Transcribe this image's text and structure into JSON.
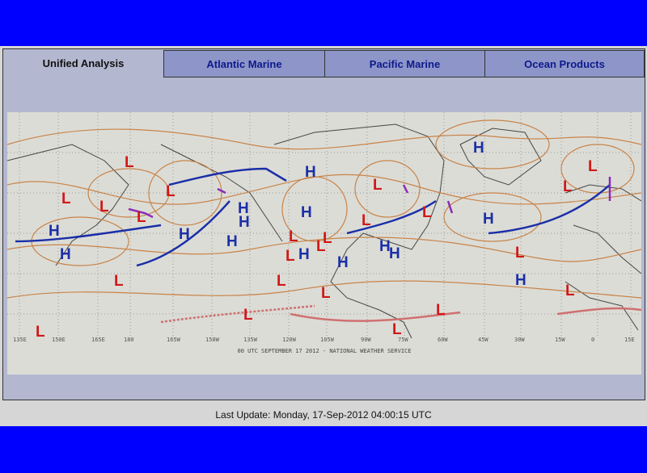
{
  "tabs": [
    {
      "label": "Unified Analysis",
      "active": true
    },
    {
      "label": "Atlantic Marine"
    },
    {
      "label": "Pacific Marine"
    },
    {
      "label": "Ocean Products"
    }
  ],
  "map": {
    "caption": "00 UTC SEPTEMBER 17 2012 - NATIONAL WEATHER SERVICE",
    "longitude_ticks": [
      "135E",
      "150E",
      "165E",
      "180",
      "165W",
      "150W",
      "135W",
      "120W",
      "105W",
      "90W",
      "75W",
      "60W",
      "45W",
      "30W",
      "15W",
      "0",
      "15E"
    ],
    "high_label": "H",
    "low_label": "L",
    "colors": {
      "high": "#1b2fa8",
      "low": "#d01818",
      "isobar": "#c8844a",
      "front_cold": "#1b2fa8",
      "front_warm": "#d01818",
      "occluded": "#8a2bb8"
    }
  },
  "footer": {
    "last_update": "Last Update: Monday, 17-Sep-2012 04:00:15 UTC"
  }
}
